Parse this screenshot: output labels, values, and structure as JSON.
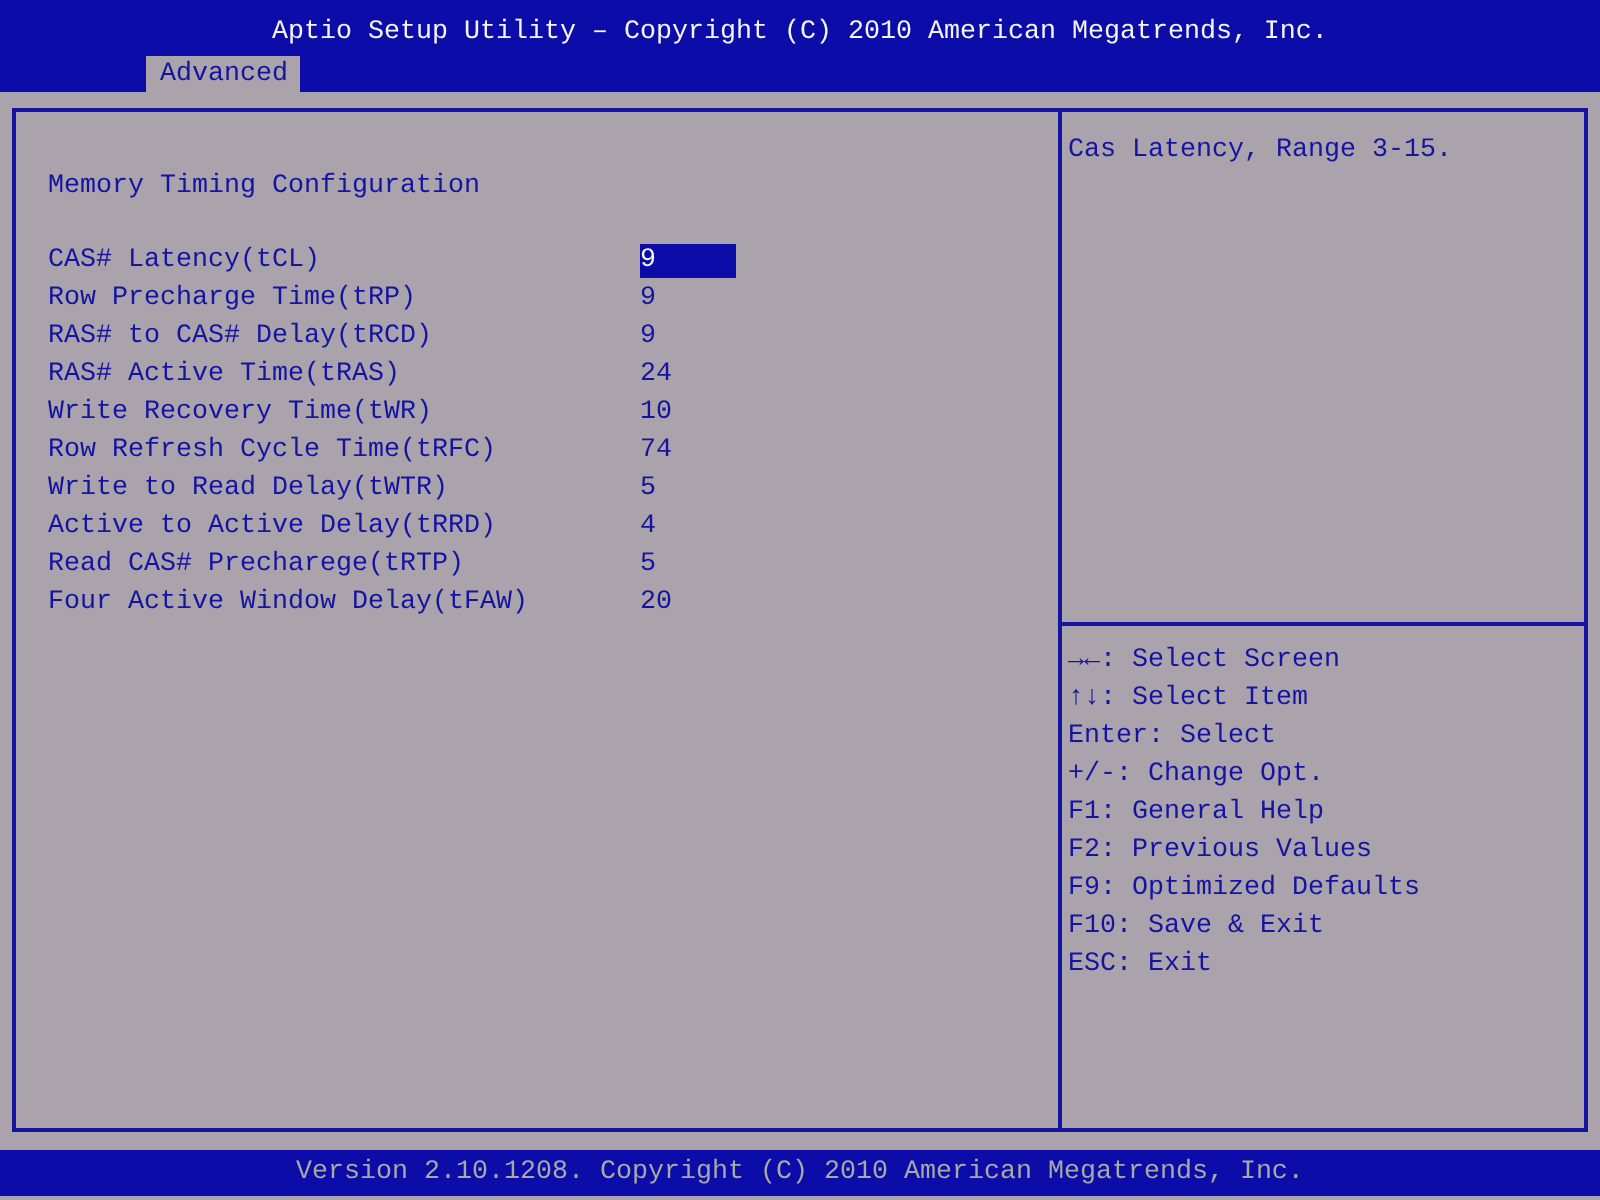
{
  "title": "Aptio Setup Utility – Copyright (C) 2010 American Megatrends, Inc.",
  "tabs": [
    {
      "label": "Advanced",
      "selected": true
    }
  ],
  "section_title": "Memory Timing Configuration",
  "items": [
    {
      "label": "CAS# Latency(tCL)",
      "value": "9",
      "selected": true
    },
    {
      "label": "Row Precharge Time(tRP)",
      "value": "9",
      "selected": false
    },
    {
      "label": "RAS# to CAS# Delay(tRCD)",
      "value": "9",
      "selected": false
    },
    {
      "label": "RAS# Active Time(tRAS)",
      "value": "24",
      "selected": false
    },
    {
      "label": "Write Recovery Time(tWR)",
      "value": "10",
      "selected": false
    },
    {
      "label": "Row Refresh Cycle Time(tRFC)",
      "value": "74",
      "selected": false
    },
    {
      "label": "Write to Read Delay(tWTR)",
      "value": "5",
      "selected": false
    },
    {
      "label": "Active to Active Delay(tRRD)",
      "value": "4",
      "selected": false
    },
    {
      "label": "Read CAS# Precharege(tRTP)",
      "value": "5",
      "selected": false
    },
    {
      "label": "Four Active Window Delay(tFAW)",
      "value": "20",
      "selected": false
    }
  ],
  "help_text": "Cas Latency, Range 3-15.",
  "key_help": [
    "→←: Select Screen",
    "↑↓: Select Item",
    "Enter: Select",
    "+/-: Change Opt.",
    "F1: General Help",
    "F2: Previous Values",
    "F9: Optimized Defaults",
    "F10: Save & Exit",
    "ESC: Exit"
  ],
  "status_bar": "Version 2.10.1208. Copyright (C) 2010 American Megatrends, Inc."
}
